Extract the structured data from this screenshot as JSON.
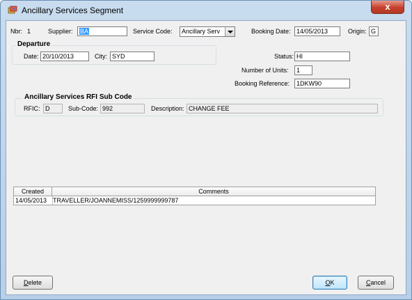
{
  "window": {
    "title": "Ancillary Services Segment",
    "close_label": "x"
  },
  "top": {
    "nbr_label": "Nbr:",
    "nbr_value": "1",
    "supplier_label": "Supplier:",
    "supplier_value": "BA",
    "service_code_label": "Service Code:",
    "service_code_value": "Ancillary Serv",
    "booking_date_label": "Booking Date:",
    "booking_date_value": "14/05/2013",
    "origin_label": "Origin:",
    "origin_value": "G"
  },
  "departure": {
    "title": "Departure",
    "date_label": "Date:",
    "date_value": "20/10/2013",
    "city_label": "City:",
    "city_value": "SYD"
  },
  "status": {
    "status_label": "Status:",
    "status_value": "HI",
    "units_label": "Number of Units:",
    "units_value": "1",
    "booking_ref_label": "Booking Reference:",
    "booking_ref_value": "1DKW90"
  },
  "rfi": {
    "title": "Ancillary Services RFI Sub Code",
    "rfic_label": "RFIC:",
    "rfic_value": "D",
    "subcode_label": "Sub-Code:",
    "subcode_value": "992",
    "description_label": "Description:",
    "description_value": "CHANGE FEE"
  },
  "grid": {
    "columns": [
      "Created",
      "Comments"
    ],
    "rows": [
      {
        "created": "14/05/2013",
        "comments": "TRAVELLER/JOANNEMISS/1259999999787"
      }
    ]
  },
  "buttons": {
    "delete_first": "D",
    "delete_rest": "elete",
    "ok_first": "O",
    "ok_rest": "K",
    "cancel_first": "C",
    "cancel_rest": "ancel"
  },
  "colors": {
    "title_gradient_top": "#c9dcef",
    "selection": "#3399ff",
    "close_button": "#c7402a"
  },
  "icons": {
    "app": "app-icon",
    "close": "close-icon",
    "dropdown": "chevron-down-icon"
  }
}
